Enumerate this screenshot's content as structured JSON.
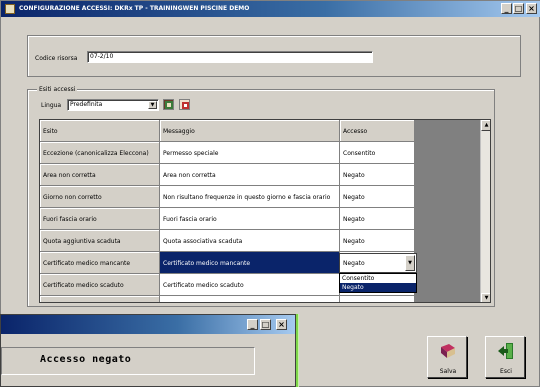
{
  "window": {
    "title": "CONFIGURAZIONE ACCESSI: DKRx TP - TRAININGWEN PISCINE DEMO",
    "controls": {
      "minimize": "_",
      "maximize": "□",
      "close": "×"
    }
  },
  "form": {
    "code_label": "Codice risorsa",
    "code_value": "07-2/10"
  },
  "outcomes": {
    "group_label": "Esiti accessi",
    "language_label": "Lingua",
    "language_value": "Predefinita"
  },
  "grid": {
    "headers": [
      "Esito",
      "Messaggio",
      "Accesso"
    ],
    "rows": [
      {
        "esito": "Eccezione (canonicalizza Eleccona)",
        "messaggio": "Permesso speciale",
        "accesso": "Consentito"
      },
      {
        "esito": "Area non corretta",
        "messaggio": "Area non corretta",
        "accesso": "Negato"
      },
      {
        "esito": "Giorno non corretto",
        "messaggio": "Non risultano frequenze in questo giorno e fascia orario",
        "accesso": "Negato"
      },
      {
        "esito": "Fuori fascia orario",
        "messaggio": "Fuori fascia orario",
        "accesso": "Negato"
      },
      {
        "esito": "Quota aggiuntiva scaduta",
        "messaggio": "Quota associativa scaduta",
        "accesso": "Negato"
      },
      {
        "esito": "Certificato medico mancante",
        "messaggio": "Certificato medico mancante",
        "accesso": "Negato",
        "selected": true
      },
      {
        "esito": "Certificato medico scaduto",
        "messaggio": "Certificato medico scaduto",
        "accesso": ""
      },
      {
        "esito": "",
        "messaggio": "",
        "accesso": ""
      }
    ],
    "dropdown_options": [
      "Consentito",
      "Negato"
    ],
    "dropdown_selected": "Negato"
  },
  "buttons": {
    "save_label": "Salva",
    "exit_label": "Esci"
  },
  "popup": {
    "message": "Accesso negato",
    "controls": {
      "minimize": "_",
      "maximize": "□",
      "close": "×"
    }
  },
  "icons": {
    "app": "app-icon",
    "language_tools": [
      "language-edit-icon",
      "language-delete-icon"
    ],
    "save": "book-icon",
    "exit": "exit-door-icon"
  },
  "colors": {
    "title_gradient_start": "#0a246a",
    "selection": "#0a246a",
    "face": "#d4d0c8",
    "accent_green": "#7fd64a"
  }
}
